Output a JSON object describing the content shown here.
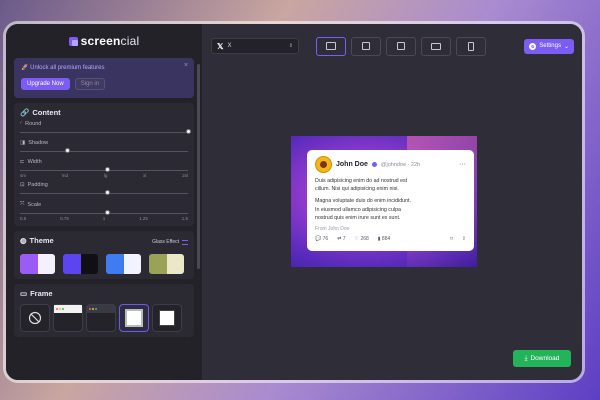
{
  "app": {
    "logo_bold": "screen",
    "logo_light": "cial"
  },
  "promo": {
    "text": "Unlock all premium features",
    "upgrade": "Upgrade Now",
    "signin": "Sign in",
    "close": "×"
  },
  "content": {
    "title": "Content",
    "round": {
      "label": "Round",
      "value_fraction": 1.0
    },
    "shadow": {
      "label": "Shadow",
      "value_fraction": 0.28
    },
    "width": {
      "label": "Width",
      "value_fraction": 0.52,
      "ticks": [
        "sm",
        "md",
        "lg",
        "xl",
        "2xl"
      ]
    },
    "padding": {
      "label": "Padding",
      "value_fraction": 0.52
    },
    "scale": {
      "label": "Scale",
      "value_fraction": 0.52,
      "ticks": [
        "0.5",
        "0.75",
        "1",
        "1.25",
        "1.5"
      ]
    }
  },
  "theme": {
    "title": "Theme",
    "glass_label": "Glass Effect",
    "swatches": [
      [
        "#9b5cf5",
        "#f4f1ff"
      ],
      [
        "#5a45f0",
        "#0f0f14"
      ],
      [
        "#3f7cf0",
        "#f1f4ff"
      ],
      [
        "#9aa257",
        "#ece7c9"
      ]
    ]
  },
  "frame": {
    "title": "Frame"
  },
  "toolbar": {
    "platform": "X",
    "settings": "Settings",
    "ratio_count": 5
  },
  "tweet": {
    "name": "John Doe",
    "handle": "@johndoe · 22h",
    "p1a": "Duis adipisicing enim do ad nostrud est",
    "p1b": "cillum. Nisi qui adipisicing enim nisi.",
    "p2a": "Magna voluptate duis do enim incididunt.",
    "p2b": "In eiusmod ullamco adipisicing culpa",
    "p2c": "nostrud quis enim irure sunt ex sunt.",
    "from": "From John Doe",
    "replies": "76",
    "retweets": "7",
    "likes": "268",
    "views": "884"
  },
  "download": {
    "label": "Download"
  },
  "colors": {
    "accent": "#7b5cf5",
    "download": "#23b45a"
  }
}
